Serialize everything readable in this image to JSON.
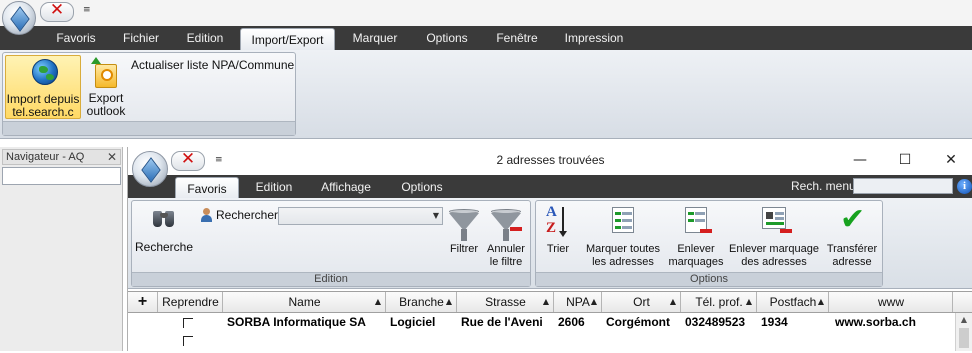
{
  "outer": {
    "tabs": [
      "Favoris",
      "Fichier",
      "Edition",
      "Import/Export",
      "Marquer",
      "Options",
      "Fenêtre",
      "Impression"
    ],
    "active_tab": "Import/Export",
    "ribbon": {
      "import_label_1": "Import depuis",
      "import_label_2": "tel.search.c",
      "export_label_1": "Export",
      "export_label_2": "outlook",
      "update_label": "Actualiser liste NPA/Commune"
    }
  },
  "navigator": {
    "title": "Navigateur - AQ",
    "close": "✕"
  },
  "inner": {
    "title": "2 adresses trouvées",
    "window_buttons": {
      "minimize": "—",
      "maximize": "☐",
      "close": "✕"
    },
    "tabs": [
      "Favoris",
      "Edition",
      "Affichage",
      "Options"
    ],
    "active_tab": "Favoris",
    "rech_menu_label": "Rech. menu",
    "help": "i",
    "ribbon": {
      "edition_group": {
        "title": "Edition",
        "recherche": "Recherche",
        "rechercher": "Rechercher",
        "filtrer": "Filtrer",
        "annuler_1": "Annuler",
        "annuler_2": "le filtre"
      },
      "options_group": {
        "title": "Options",
        "trier": "Trier",
        "marquer_1": "Marquer toutes",
        "marquer_2": "les adresses",
        "enlever_1": "Enlever",
        "enlever_2": "marquages",
        "enlever_marquage_1": "Enlever marquage",
        "enlever_marquage_2": "des adresses",
        "transferer_1": "Transférer",
        "transferer_2": "adresse"
      }
    },
    "grid": {
      "plus": "+",
      "columns": [
        "Reprendre",
        "Name",
        "Branche",
        "Strasse",
        "NPA",
        "Ort",
        "Tél. prof.",
        "Postfach",
        "www"
      ],
      "rows": [
        {
          "name": "SORBA Informatique SA",
          "branche": "Logiciel",
          "strasse": "Rue de l'Aveni",
          "npa": "2606",
          "ort": "Corgémont",
          "tel": "032489523",
          "postfach": "1934",
          "www": "www.sorba.ch"
        },
        {
          "name": "",
          "branche": "",
          "strasse": "",
          "npa": "",
          "ort": "",
          "tel": "",
          "postfach": "",
          "www": ""
        }
      ]
    }
  },
  "colors": {
    "tabbar": "#3a3a3a",
    "accent": "#ffd965",
    "close_red": "#d01010"
  }
}
